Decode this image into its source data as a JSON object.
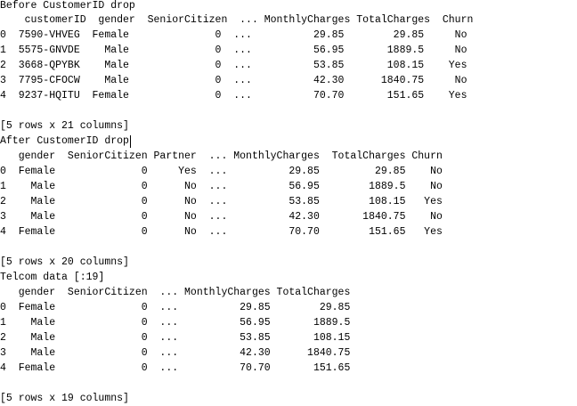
{
  "output": {
    "block1": {
      "title": "Before CustomerID drop",
      "header": "    customerID  gender  SeniorCitizen  ... MonthlyCharges TotalCharges  Churn",
      "rows": [
        "0  7590-VHVEG  Female              0  ...          29.85        29.85     No",
        "1  5575-GNVDE    Male              0  ...          56.95       1889.5     No",
        "2  3668-QPYBK    Male              0  ...          53.85       108.15    Yes",
        "3  7795-CFOCW    Male              0  ...          42.30      1840.75     No",
        "4  9237-HQITU  Female              0  ...          70.70       151.65    Yes"
      ],
      "footer": "[5 rows x 21 columns]"
    },
    "block2": {
      "title": "After CustomerID drop",
      "header": "   gender  SeniorCitizen Partner  ... MonthlyCharges  TotalCharges Churn",
      "rows": [
        "0  Female              0     Yes  ...          29.85         29.85    No",
        "1    Male              0      No  ...          56.95        1889.5    No",
        "2    Male              0      No  ...          53.85        108.15   Yes",
        "3    Male              0      No  ...          42.30       1840.75    No",
        "4  Female              0      No  ...          70.70        151.65   Yes"
      ],
      "footer": "[5 rows x 20 columns]"
    },
    "block3": {
      "title": "Telcom data [:19]",
      "header": "   gender  SeniorCitizen  ... MonthlyCharges TotalCharges",
      "rows": [
        "0  Female              0  ...          29.85        29.85",
        "1    Male              0  ...          56.95       1889.5",
        "2    Male              0  ...          53.85       108.15",
        "3    Male              0  ...          42.30      1840.75",
        "4  Female              0  ...          70.70       151.65"
      ],
      "footer": "[5 rows x 19 columns]"
    }
  }
}
